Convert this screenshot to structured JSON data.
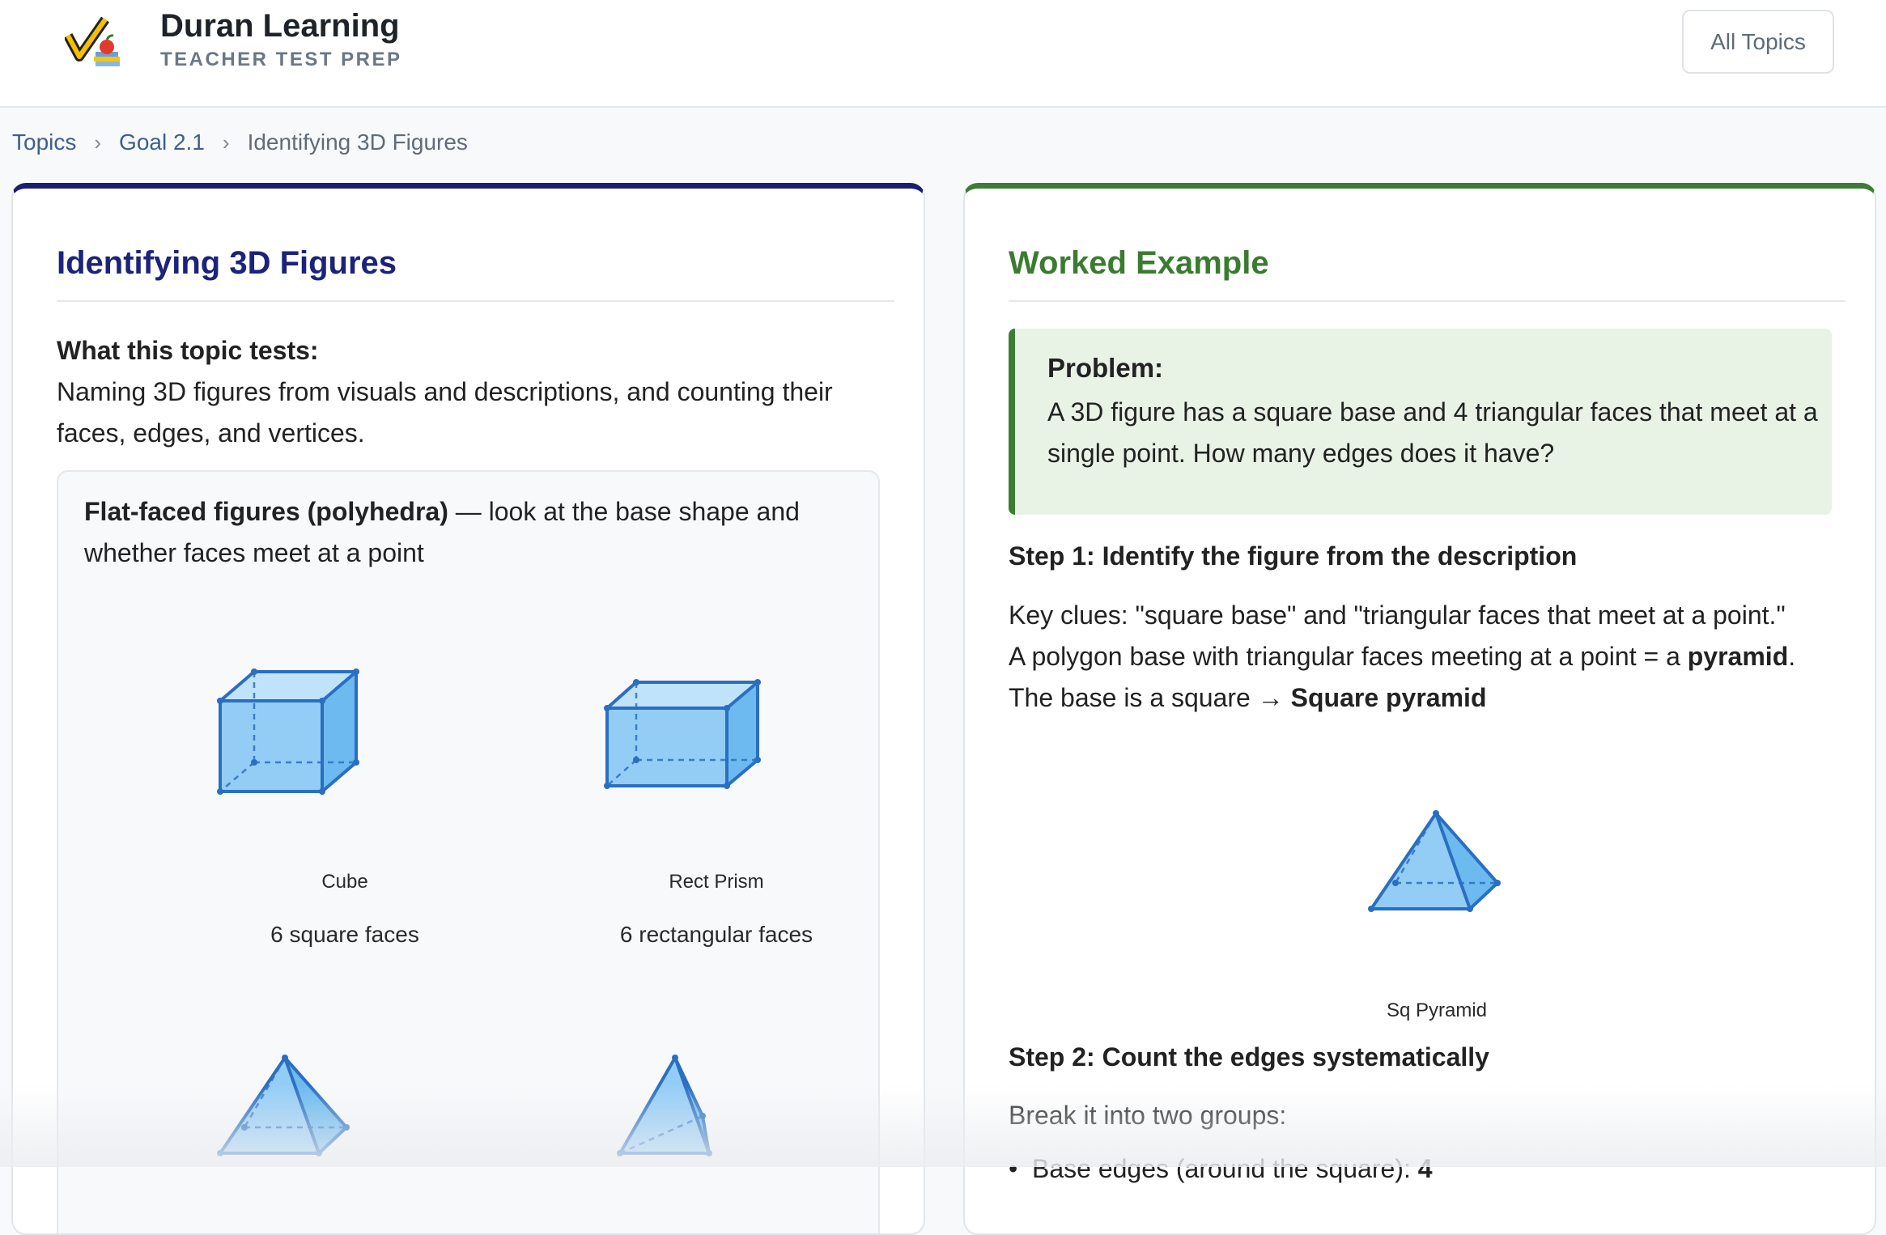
{
  "header": {
    "logo_icon": "checkmark-apple-books-logo",
    "brand_title": "Duran Learning",
    "brand_subtitle": "TEACHER TEST PREP",
    "all_topics_label": "All Topics"
  },
  "breadcrumb": {
    "items": [
      "Topics",
      "Goal 2.1",
      "Identifying 3D Figures"
    ],
    "separator": "›"
  },
  "left_card": {
    "accent_color": "#1b1f6e",
    "title": "Identifying 3D Figures",
    "tests_heading": "What this topic tests:",
    "tests_text": "Naming 3D figures from visuals and descriptions, and counting their faces, edges, and vertices.",
    "box_heading_bold": "Flat-faced figures (polyhedra)",
    "box_heading_rest": " — look at the base shape and whether faces meet at a point",
    "figures": [
      {
        "label": "Cube",
        "desc": "6 square faces",
        "icon": "cube-icon"
      },
      {
        "label": "Rect Prism",
        "desc": "6 rectangular faces",
        "icon": "rectangular-prism-icon"
      },
      {
        "label": "",
        "desc": "",
        "icon": "square-pyramid-icon"
      },
      {
        "label": "",
        "desc": "",
        "icon": "triangular-pyramid-icon"
      }
    ]
  },
  "right_card": {
    "accent_color": "#3b7d34",
    "title": "Worked Example",
    "problem_label": "Problem:",
    "problem_text": "A 3D figure has a square base and 4 triangular faces that meet at a single point. How many edges does it have?",
    "step1_heading": "Step 1: Identify the figure from the description",
    "step1_line1": "Key clues: \"square base\" and \"triangular faces that meet at a point.\"",
    "step1_line2_pre": "A polygon base with triangular faces meeting at a point = a ",
    "step1_line2_bold": "pyramid",
    "step1_line2_post": ".",
    "step1_line3_pre": "The base is a square → ",
    "step1_line3_bold": "Square pyramid",
    "figure_label": "Sq Pyramid",
    "step2_heading": "Step 2: Count the edges systematically",
    "step2_text": "Break it into two groups:",
    "step2_bullet_pre": "Base edges (around the square): ",
    "step2_bullet_bold": "4"
  }
}
